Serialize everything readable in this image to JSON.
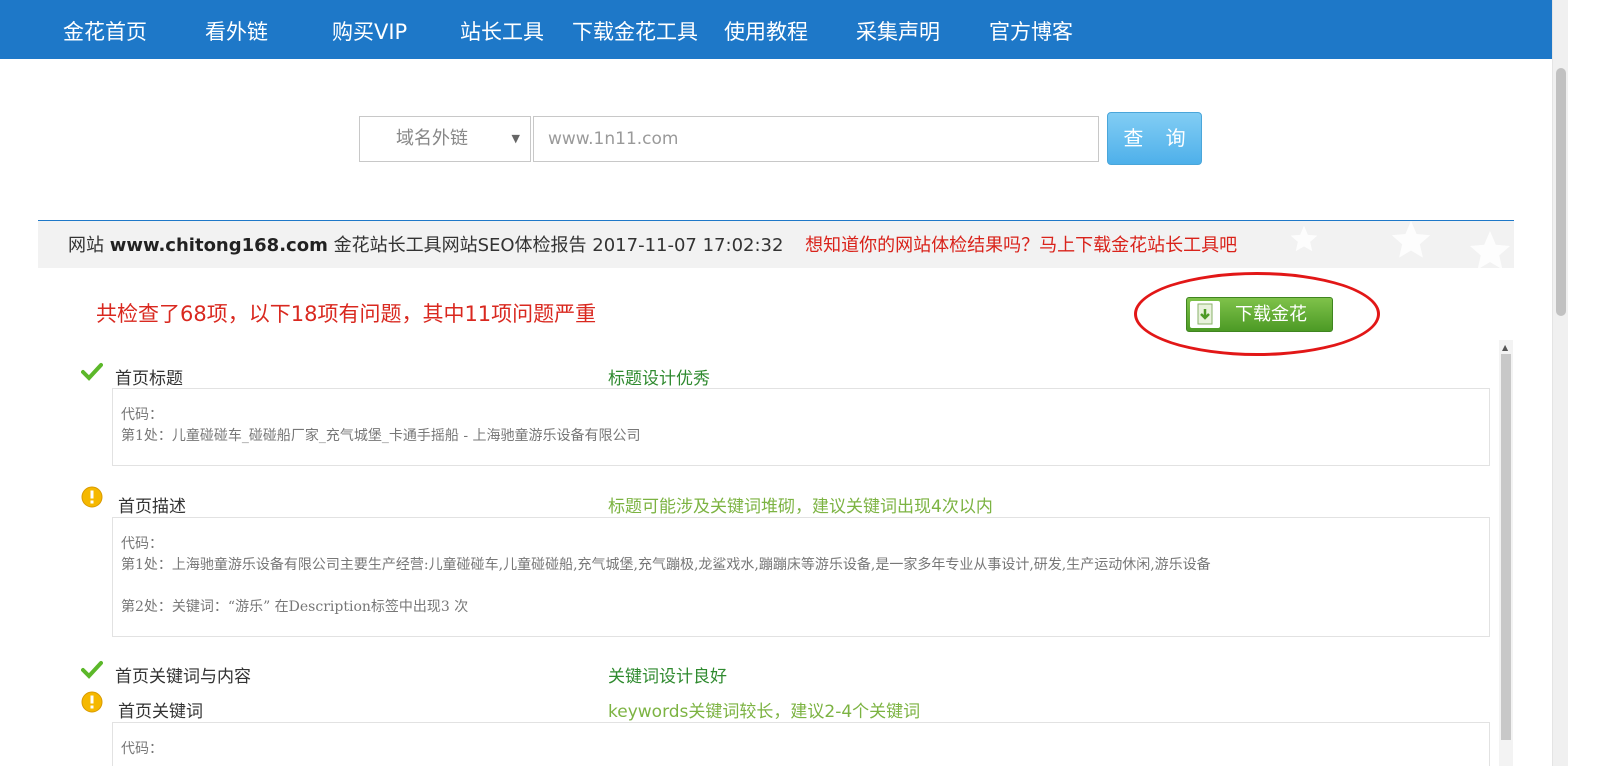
{
  "nav": {
    "items": [
      "金花首页",
      "看外链",
      "购买VIP",
      "站长工具",
      "下载金花工具",
      "使用教程",
      "采集声明",
      "官方博客"
    ],
    "bg_color": "#1e78c8"
  },
  "search": {
    "type_label": "域名外链",
    "placeholder": "www.1n11.com",
    "button_label": "查 询"
  },
  "report": {
    "prefix": "网站",
    "domain": "www.chitong168.com",
    "title_text": "金花站长工具网站SEO体检报告 2017-11-07 17:02:32",
    "promo": "想知道你的网站体检结果吗？马上下载金花站长工具吧",
    "issue_summary": "共检查了68项，以下18项有问题，其中11项问题严重",
    "download_label": "下载金花"
  },
  "items": [
    {
      "status": "ok",
      "icon": "checkmark-icon",
      "name": "首页标题",
      "result": "标题设计优秀",
      "code": [
        "代码：",
        "第1处：儿童碰碰车_碰碰船厂家_充气城堡_卡通手摇船 - 上海驰童游乐设备有限公司"
      ]
    },
    {
      "status": "warning",
      "icon": "warning-icon",
      "name": "首页描述",
      "result": "标题可能涉及关键词堆砌，建议关键词出现4次以内",
      "code": [
        "代码：",
        "第1处：上海驰童游乐设备有限公司主要生产经营:儿童碰碰车,儿童碰碰船,充气城堡,充气蹦极,龙鲨戏水,蹦蹦床等游乐设备,是一家多年专业从事设计,研发,生产运动休闲,游乐设备",
        "",
        "第2处：关键词：“游乐” 在Description标签中出现3 次"
      ]
    },
    {
      "status": "ok",
      "icon": "checkmark-icon",
      "name": "首页关键词与内容",
      "result": "关键词设计良好"
    },
    {
      "status": "warning",
      "icon": "warning-icon",
      "name": "首页关键词",
      "result": "keywords关键词较长，建议2-4个关键词",
      "code": [
        "代码："
      ]
    }
  ]
}
